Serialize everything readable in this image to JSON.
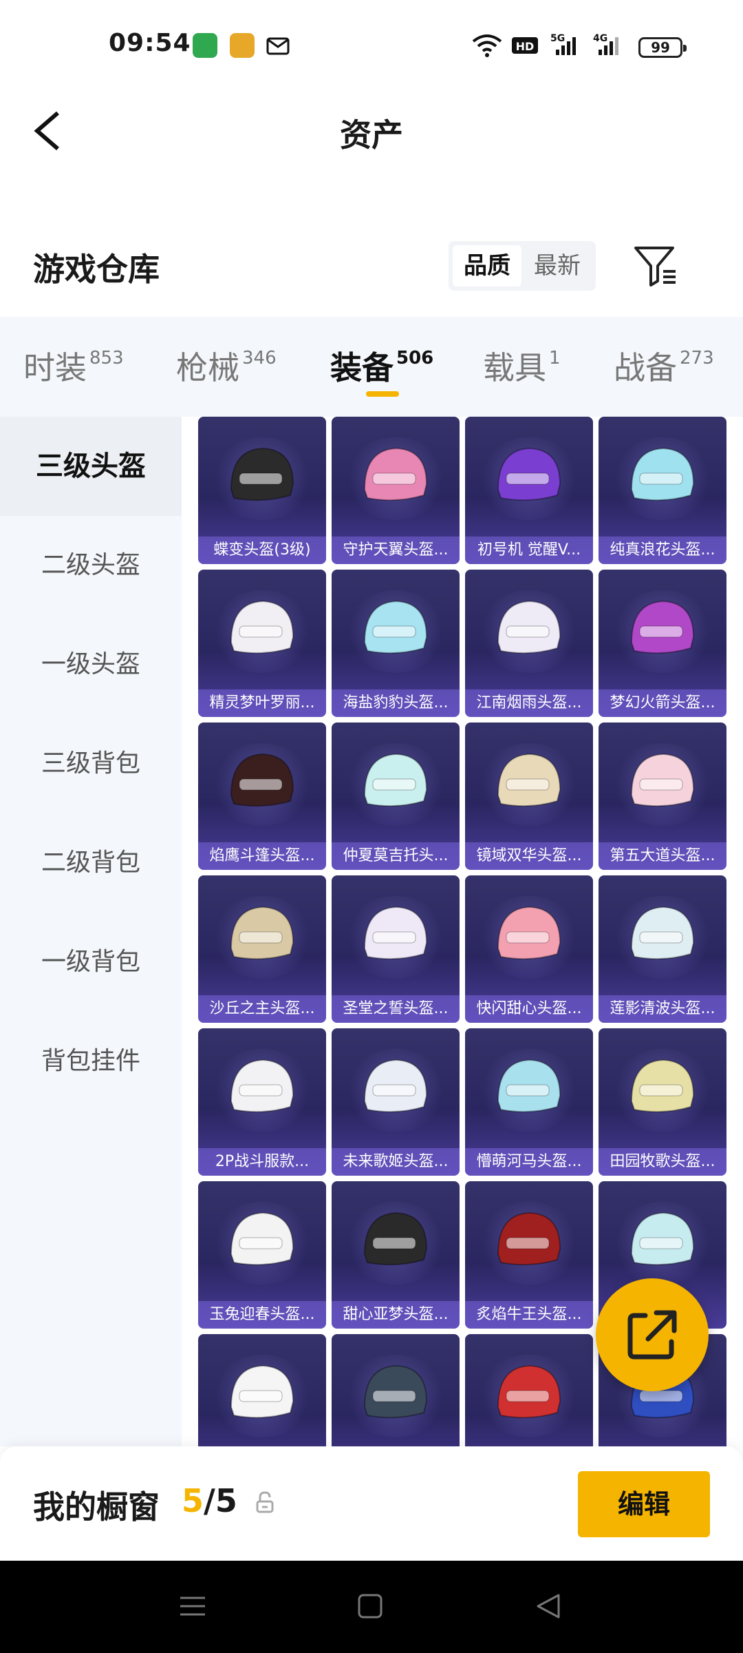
{
  "status_bar": {
    "time": "09:54",
    "battery": "99",
    "icons": [
      "app-icon-1",
      "app-icon-2",
      "mail-icon",
      "wifi-icon",
      "hd-icon",
      "signal-5g-icon",
      "signal-4g-icon",
      "battery-icon"
    ]
  },
  "header": {
    "title": "资产",
    "back_icon": "chevron-left-icon"
  },
  "warehouse": {
    "title": "游戏仓库",
    "sort_options": [
      "品质",
      "最新"
    ],
    "sort_selected": "品质",
    "filter_icon": "filter-icon"
  },
  "tabs": [
    {
      "label": "时装",
      "count": "853"
    },
    {
      "label": "枪械",
      "count": "346"
    },
    {
      "label": "装备",
      "count": "506"
    },
    {
      "label": "载具",
      "count": "1"
    },
    {
      "label": "战备",
      "count": "273"
    }
  ],
  "active_tab": "装备",
  "sidebar": {
    "items": [
      "三级头盔",
      "二级头盔",
      "一级头盔",
      "三级背包",
      "二级背包",
      "一级背包",
      "背包挂件"
    ],
    "active": "三级头盔"
  },
  "items": [
    "蝶变头盔(3级)",
    "守护天翼头盔...",
    "初号机 觉醒V...",
    "纯真浪花头盔...",
    "精灵梦叶罗丽...",
    "海盐豹豹头盔...",
    "江南烟雨头盔...",
    "梦幻火箭头盔...",
    "焰鹰斗篷头盔...",
    "仲夏莫吉托头...",
    "镜域双华头盔...",
    "第五大道头盔...",
    "沙丘之主头盔...",
    "圣堂之誓头盔...",
    "快闪甜心头盔...",
    "莲影清波头盔...",
    "2P战斗服款...",
    "未来歌姬头盔...",
    "懵萌河马头盔...",
    "田园牧歌头盔...",
    "玉兔迎春头盔...",
    "甜心亚梦头盔...",
    "炙焰牛王头盔...",
    "",
    "",
    "",
    "",
    ""
  ],
  "helmet_colors": [
    "#2b2b2b",
    "#e886b4",
    "#7a3fd0",
    "#9fe1ef",
    "#f1eef4",
    "#a7e3f1",
    "#eeeaf6",
    "#b048c8",
    "#3b1f1f",
    "#c9f0ee",
    "#e8d9b8",
    "#f6d3dc",
    "#d9c9a4",
    "#efe9f7",
    "#f3a0b0",
    "#dfeef2",
    "#f2f2f4",
    "#e9eef6",
    "#a9e0ee",
    "#e6e0a6",
    "#f3f3f3",
    "#2a2a2a",
    "#a02020",
    "#c7ecf0",
    "#f5f5f5",
    "#3a4a5a",
    "#d03030",
    "#2f4fc0"
  ],
  "fab": {
    "icon": "share-external-icon"
  },
  "showcase": {
    "label": "我的橱窗",
    "current": "5",
    "separator": "/",
    "total": "5",
    "lock_icon": "lock-icon",
    "edit_label": "编辑"
  },
  "nav": {
    "icons": [
      "menu-icon",
      "home-icon",
      "back-triangle-icon"
    ]
  }
}
